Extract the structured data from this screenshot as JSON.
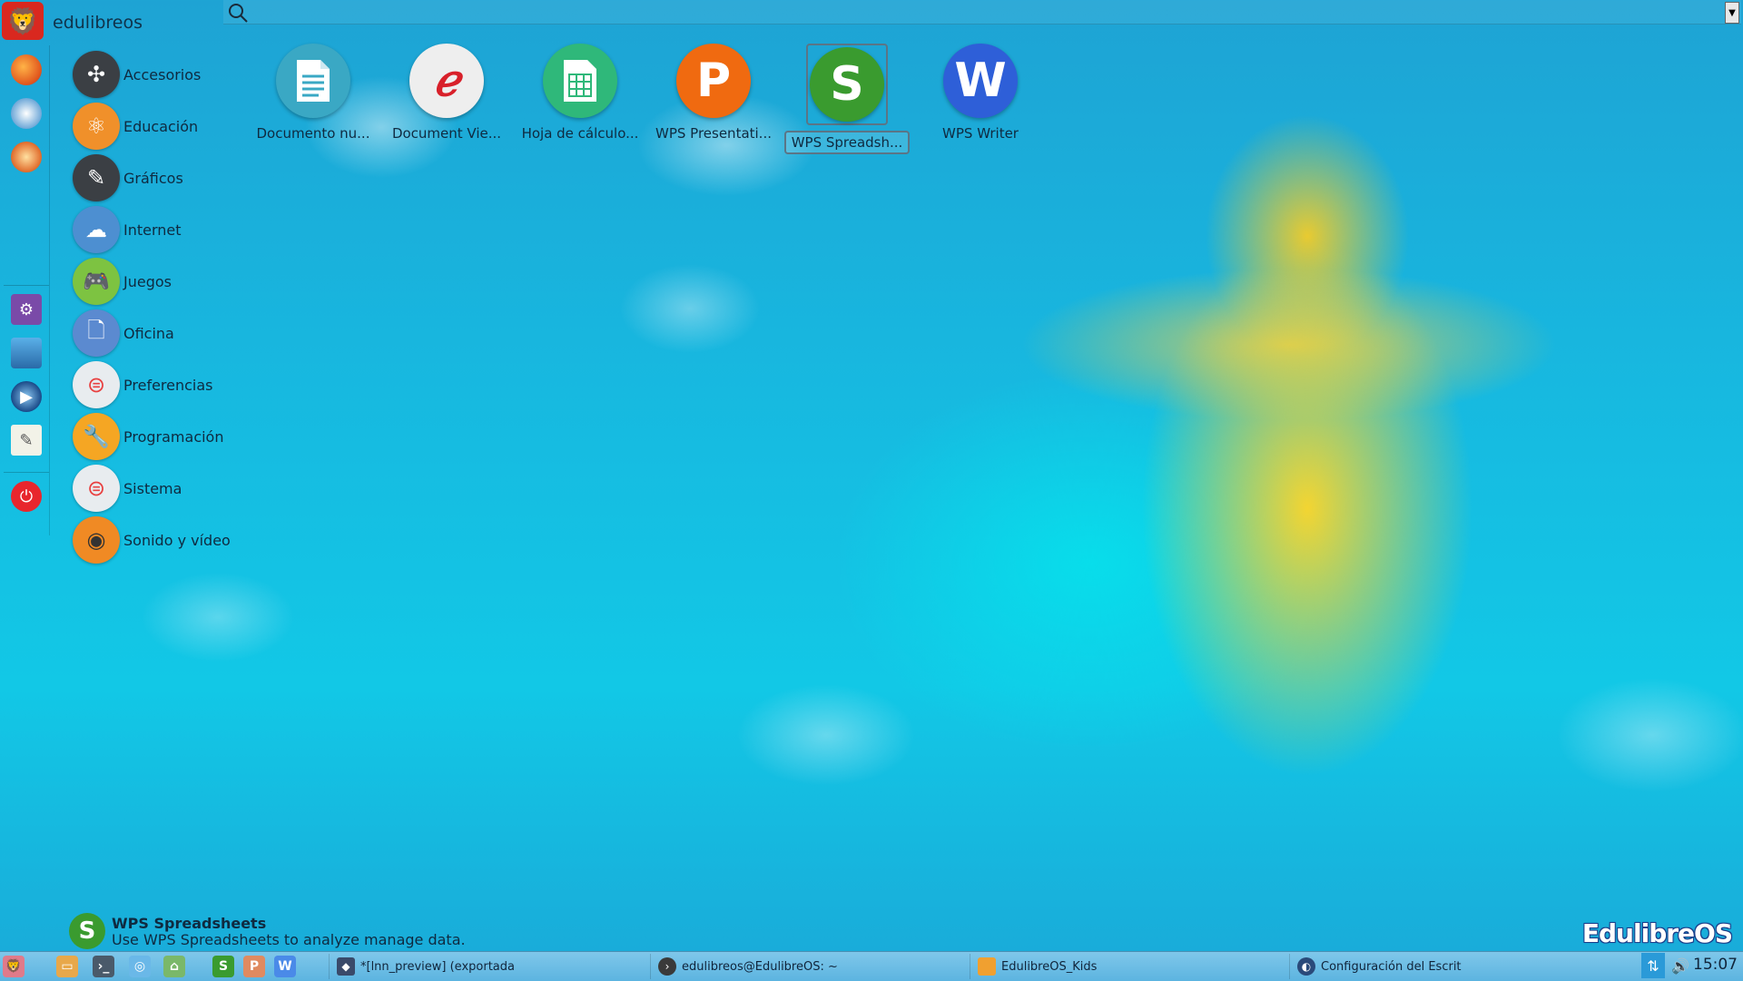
{
  "menu": {
    "title": "edulibreos"
  },
  "search": {
    "placeholder": "",
    "value": ""
  },
  "dock": [
    "firefox-icon",
    "thunderbird-icon",
    "tux-paint-icon",
    "settings-icon",
    "monitor-icon",
    "media-player-icon",
    "text-editor-icon",
    "power-icon"
  ],
  "categories": [
    {
      "label": "Accesorios",
      "color": "#3b3f44"
    },
    {
      "label": "Educación",
      "color": "#f0902a"
    },
    {
      "label": "Gráficos",
      "color": "#3b3f44"
    },
    {
      "label": "Internet",
      "color": "#4d8fd1"
    },
    {
      "label": "Juegos",
      "color": "#7dc341"
    },
    {
      "label": "Oficina",
      "color": "#5b8ad0"
    },
    {
      "label": "Preferencias",
      "color": "#e8ecef"
    },
    {
      "label": "Programación",
      "color": "#f5a623"
    },
    {
      "label": "Sistema",
      "color": "#e8ecef"
    },
    {
      "label": "Sonido y vídeo",
      "color": "#f08a24"
    }
  ],
  "apps": [
    {
      "label": "Documento nu...",
      "letter": "",
      "color": "#3aa8c4"
    },
    {
      "label": "Document Vie...",
      "letter": "",
      "color": "#eeeeee"
    },
    {
      "label": "Hoja de cálculo...",
      "letter": "",
      "color": "#2fb87a"
    },
    {
      "label": "WPS Presentati...",
      "letter": "P",
      "color": "#f06a10"
    },
    {
      "label": "WPS Spreadsh...",
      "letter": "S",
      "color": "#3a9b2f"
    },
    {
      "label": "WPS Writer",
      "letter": "W",
      "color": "#2e5fd8"
    }
  ],
  "description": {
    "title": "WPS Spreadsheets",
    "text": "Use WPS Spreadsheets to analyze manage data."
  },
  "brand": "EdulibreOS",
  "taskbar": {
    "tasks": [
      {
        "label": "*[lnn_preview] (exportada"
      },
      {
        "label": "edulibreos@EdulibreOS: ~"
      },
      {
        "label": "EdulibreOS_Kids"
      },
      {
        "label": "Configuración del Escrit"
      }
    ],
    "clock": "15:07"
  }
}
